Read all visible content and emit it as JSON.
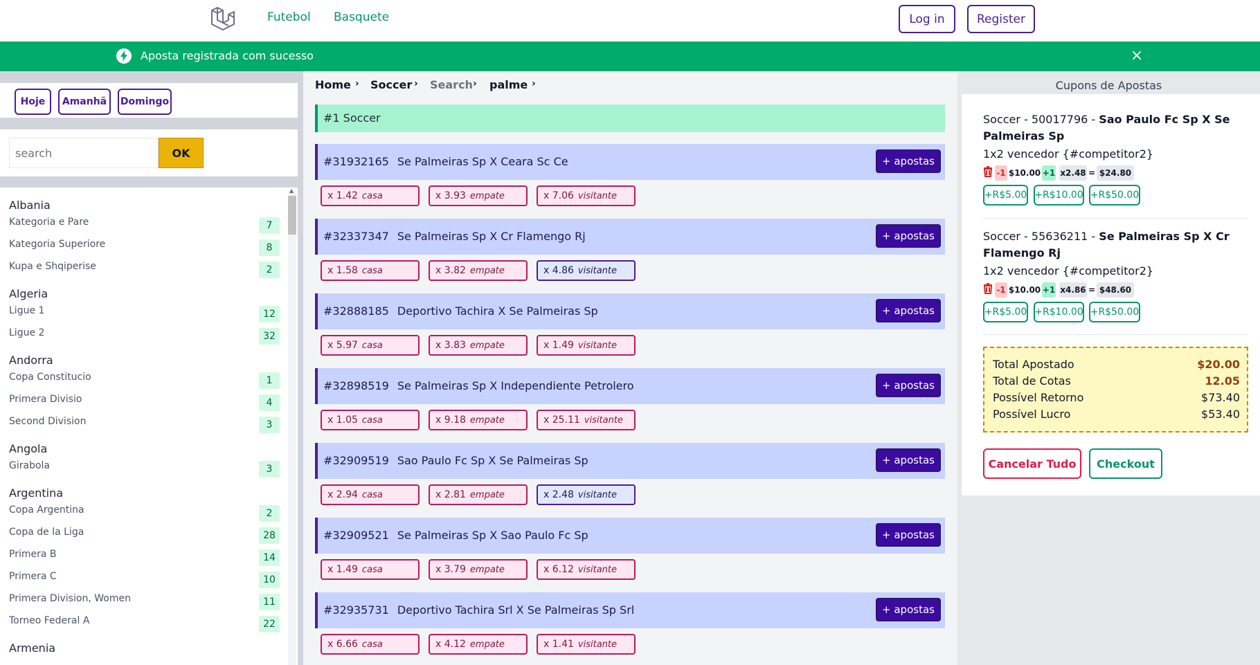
{
  "nav": {
    "links": [
      "Futebol",
      "Basquete"
    ],
    "login": "Log in",
    "register": "Register",
    "logo_icon": "laravel-logo-icon"
  },
  "flash": {
    "message": "Aposta registrada com sucesso",
    "icon": "bolt-icon",
    "close": "×",
    "color": "#00ab6b"
  },
  "days": [
    "Hoje",
    "Amanhã",
    "Domingo"
  ],
  "search": {
    "placeholder": "search",
    "button": "OK"
  },
  "sidebar": {
    "countries": [
      {
        "name": "Albania",
        "leagues": [
          {
            "name": "Kategoria e Pare",
            "count": "7"
          },
          {
            "name": "Kategoria Superiore",
            "count": "8"
          },
          {
            "name": "Kupa e Shqiperise",
            "count": "2"
          }
        ]
      },
      {
        "name": "Algeria",
        "leagues": [
          {
            "name": "Ligue 1",
            "count": "12"
          },
          {
            "name": "Ligue 2",
            "count": "32"
          }
        ]
      },
      {
        "name": "Andorra",
        "leagues": [
          {
            "name": "Copa Constitucio",
            "count": "1"
          },
          {
            "name": "Primera Divisio",
            "count": "4"
          },
          {
            "name": "Second Division",
            "count": "3"
          }
        ]
      },
      {
        "name": "Angola",
        "leagues": [
          {
            "name": "Girabola",
            "count": "3"
          }
        ]
      },
      {
        "name": "Argentina",
        "leagues": [
          {
            "name": "Copa Argentina",
            "count": "2"
          },
          {
            "name": "Copa de la Liga",
            "count": "28"
          },
          {
            "name": "Primera B",
            "count": "14"
          },
          {
            "name": "Primera C",
            "count": "10"
          },
          {
            "name": "Primera Division, Women",
            "count": "11"
          },
          {
            "name": "Torneo Federal A",
            "count": "22"
          }
        ]
      },
      {
        "name": "Armenia",
        "leagues": []
      }
    ]
  },
  "breadcrumb": [
    "Home",
    "Soccer",
    "Search",
    "palme"
  ],
  "sport_header": "#1   Soccer",
  "apostas_label": "+ apostas",
  "odd_labels": {
    "home": "casa",
    "draw": "empate",
    "away": "visitante"
  },
  "matches": [
    {
      "id": "#31932165",
      "name": "Se Palmeiras Sp X Ceara Sc Ce",
      "odds": [
        "x 1.42",
        "x 3.93",
        "x 7.06"
      ],
      "selected": -1
    },
    {
      "id": "#32337347",
      "name": "Se Palmeiras Sp X Cr Flamengo Rj",
      "odds": [
        "x 1.58",
        "x 3.82",
        "x 4.86"
      ],
      "selected": 2
    },
    {
      "id": "#32888185",
      "name": "Deportivo Tachira X Se Palmeiras Sp",
      "odds": [
        "x 5.97",
        "x 3.83",
        "x 1.49"
      ],
      "selected": -1
    },
    {
      "id": "#32898519",
      "name": "Se Palmeiras Sp X Independiente Petrolero",
      "odds": [
        "x 1.05",
        "x 9.18",
        "x 25.11"
      ],
      "selected": -1
    },
    {
      "id": "#32909519",
      "name": "Sao Paulo Fc Sp X Se Palmeiras Sp",
      "odds": [
        "x 2.94",
        "x 2.81",
        "x 2.48"
      ],
      "selected": 2
    },
    {
      "id": "#32909521",
      "name": "Se Palmeiras Sp X Sao Paulo Fc Sp",
      "odds": [
        "x 1.49",
        "x 3.79",
        "x 6.12"
      ],
      "selected": -1
    },
    {
      "id": "#32935731",
      "name": "Deportivo Tachira Srl X Se Palmeiras Sp Srl",
      "odds": [
        "x 6.66",
        "x 4.12",
        "x 1.41"
      ],
      "selected": -1
    }
  ],
  "coupons": {
    "title": "Cupons de Apostas",
    "items": [
      {
        "prefix": "Soccer - 50017796 - ",
        "match": "Sao Paulo Fc Sp X Se Palmeiras Sp",
        "market": "1x2 vencedor {#competitor2}",
        "minus": "-1",
        "stake": "$10.00",
        "plus": "+1",
        "odd": "x2.48",
        "eq": "=",
        "ret": "$24.80",
        "adds": [
          "+R$5.00",
          "+R$10.00",
          "+R$50.00"
        ]
      },
      {
        "prefix": "Soccer - 55636211 - ",
        "match": "Se Palmeiras Sp X Cr Flamengo Rj",
        "market": "1x2 vencedor {#competitor2}",
        "minus": "-1",
        "stake": "$10.00",
        "plus": "+1",
        "odd": "x4.86",
        "eq": "=",
        "ret": "$48.60",
        "adds": [
          "+R$5.00",
          "+R$10.00",
          "+R$50.00"
        ]
      }
    ],
    "totals": [
      {
        "label": "Total Apostado",
        "value": "$20.00"
      },
      {
        "label": "Total de Cotas",
        "value": "12.05"
      },
      {
        "label": "Possível Retorno",
        "value": "$73.40"
      },
      {
        "label": "Possível Lucro",
        "value": "$53.40"
      }
    ],
    "cancel": "Cancelar Tudo",
    "checkout": "Checkout"
  }
}
